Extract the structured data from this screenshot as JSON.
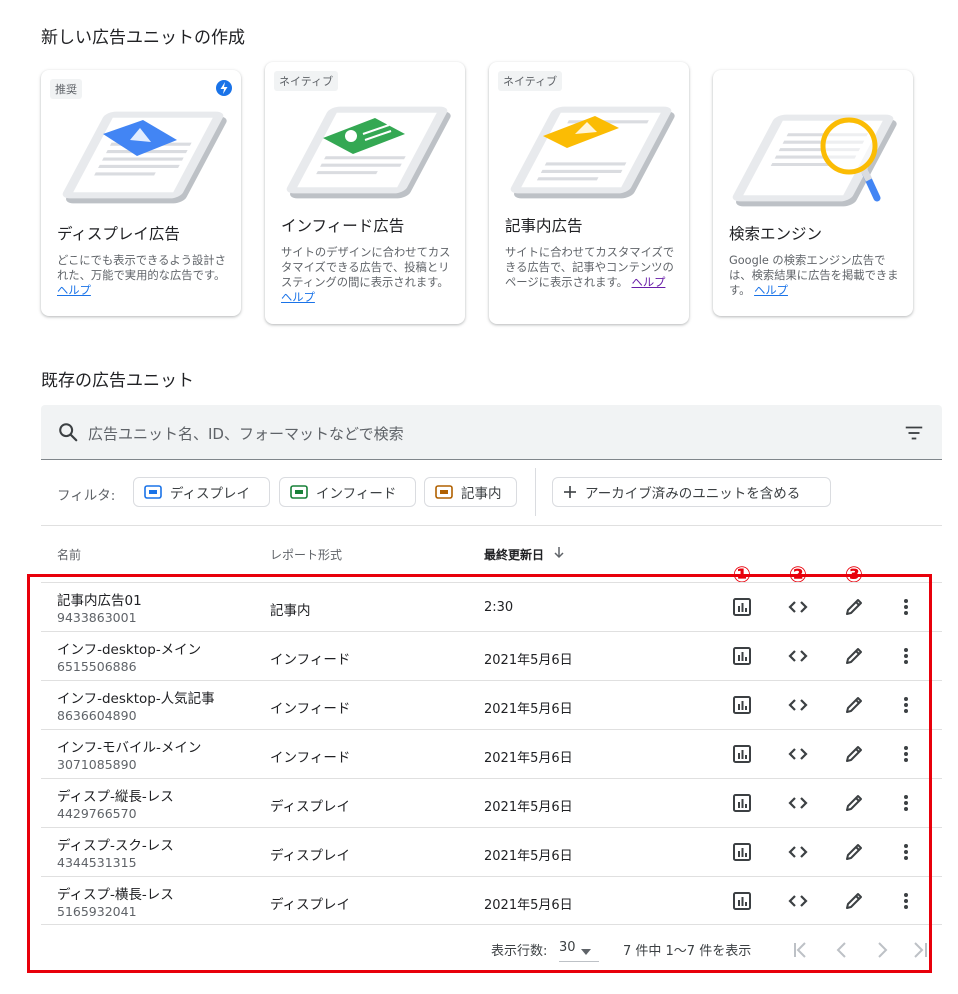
{
  "new_section": {
    "title": "新しい広告ユニットの作成"
  },
  "cards": [
    {
      "badge": "推奨",
      "title": "ディスプレイ広告",
      "desc": "どこにでも表示できるよう設計された、万能で実用的な広告です。",
      "help": "ヘルプ",
      "icon": "bolt-icon"
    },
    {
      "badge": "ネイティブ",
      "title": "インフィード広告",
      "desc": "サイトのデザインに合わせてカスタマイズできる広告で、投稿とリスティングの間に表示されます。",
      "help": "ヘルプ"
    },
    {
      "badge": "ネイティブ",
      "title": "記事内広告",
      "desc": "サイトに合わせてカスタマイズできる広告で、記事やコンテンツのページに表示されます。",
      "help": "ヘルプ"
    },
    {
      "badge": "",
      "title": "検索エンジン",
      "desc": "Google の検索エンジン広告では、検索結果に広告を掲載できます。",
      "help": "ヘルプ"
    }
  ],
  "existing_section": {
    "title": "既存の広告ユニット"
  },
  "search": {
    "placeholder": "広告ユニット名、ID、フォーマットなどで検索"
  },
  "filters": {
    "label": "フィルタ:",
    "chips": [
      "ディスプレイ",
      "インフィード",
      "記事内"
    ],
    "archive": "アーカイブ済みのユニットを含める"
  },
  "table": {
    "headers": {
      "name": "名前",
      "report": "レポート形式",
      "updated": "最終更新日"
    },
    "rows": [
      {
        "name": "記事内広告01",
        "id": "9433863001",
        "type": "記事内",
        "date": "2:30"
      },
      {
        "name": "インフ-desktop-メイン",
        "id": "6515506886",
        "type": "インフィード",
        "date": "2021年5月6日"
      },
      {
        "name": "インフ-desktop-人気記事",
        "id": "8636604890",
        "type": "インフィード",
        "date": "2021年5月6日"
      },
      {
        "name": "インフ-モバイル-メイン",
        "id": "3071085890",
        "type": "インフィード",
        "date": "2021年5月6日"
      },
      {
        "name": "ディスプ-縦長-レス",
        "id": "4429766570",
        "type": "ディスプレイ",
        "date": "2021年5月6日"
      },
      {
        "name": "ディスプ-スク-レス",
        "id": "4344531315",
        "type": "ディスプレイ",
        "date": "2021年5月6日"
      },
      {
        "name": "ディスプ-横長-レス",
        "id": "5165932041",
        "type": "ディスプレイ",
        "date": "2021年5月6日"
      }
    ]
  },
  "markers": [
    "①",
    "②",
    "③"
  ],
  "pagination": {
    "rows_label": "表示行数:",
    "rows_value": "30",
    "range": "7 件中 1〜7 件を表示"
  },
  "colors": {
    "accent": "#1a73e8",
    "highlight": "#e8000b",
    "display": "#1a73e8",
    "infeed": "#188038",
    "inarticle": "#b06000"
  }
}
